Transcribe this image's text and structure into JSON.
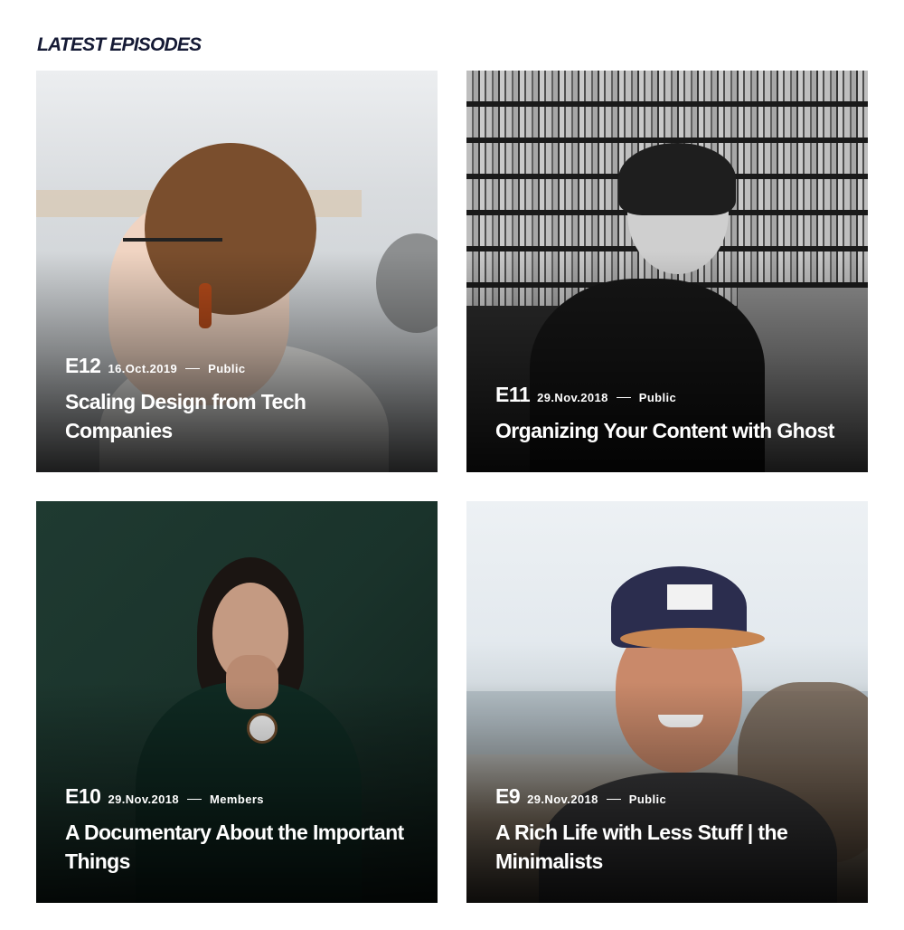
{
  "section": {
    "title": "LATEST EPISODES"
  },
  "episodes": [
    {
      "number": "E12",
      "date": "16.Oct.2019",
      "access": "Public",
      "title": "Scaling Design from Tech Companies",
      "image_alt": "Person with glasses and earring in profile"
    },
    {
      "number": "E11",
      "date": "29.Nov.2018",
      "access": "Public",
      "title": "Organizing Your Content with Ghost",
      "image_alt": "Woman in front of bookshelves"
    },
    {
      "number": "E10",
      "date": "29.Nov.2018",
      "access": "Members",
      "title": "A Documentary About the Important Things",
      "image_alt": "Woman in green hoodie resting chin on hand"
    },
    {
      "number": "E9",
      "date": "29.Nov.2018",
      "access": "Public",
      "title": "A Rich Life with Less Stuff | the Minimalists",
      "image_alt": "Smiling man wearing a cap"
    }
  ],
  "colors": {
    "heading": "#151a35",
    "overlay_text": "#ffffff"
  }
}
